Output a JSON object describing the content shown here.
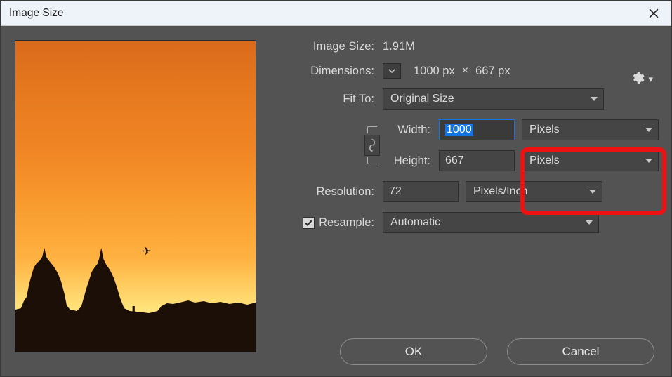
{
  "window": {
    "title": "Image Size"
  },
  "labels": {
    "image_size": "Image Size:",
    "dimensions": "Dimensions:",
    "fit_to": "Fit To:",
    "width": "Width:",
    "height": "Height:",
    "resolution": "Resolution:",
    "resample": "Resample:"
  },
  "values": {
    "image_size": "1.91M",
    "dim_w": "1000 px",
    "dim_h": "667 px",
    "fit_to": "Original Size",
    "width": "1000",
    "height": "667",
    "resolution": "72",
    "width_unit": "Pixels",
    "height_unit": "Pixels",
    "resolution_unit": "Pixels/Inch",
    "resample_mode": "Automatic"
  },
  "buttons": {
    "ok": "OK",
    "cancel": "Cancel"
  },
  "resample_checked": true
}
